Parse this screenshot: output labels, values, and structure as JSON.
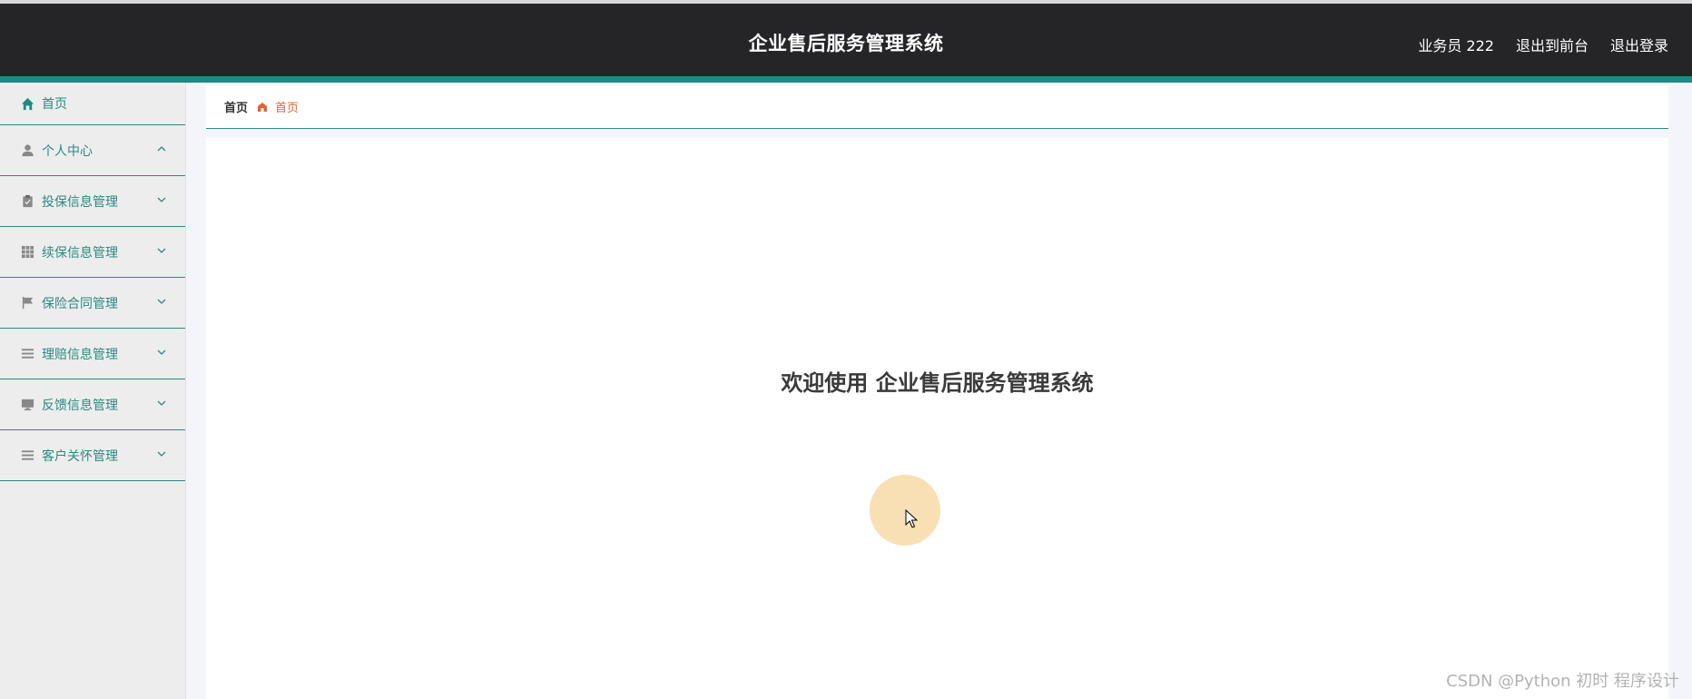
{
  "header": {
    "title": "企业售后服务管理系统",
    "user": "业务员 222",
    "back_to_front": "退出到前台",
    "logout": "退出登录"
  },
  "sidebar": {
    "items": [
      {
        "label": "首页",
        "icon": "home-icon"
      },
      {
        "label": "个人中心",
        "icon": "user-icon",
        "expanded": true
      },
      {
        "label": "投保信息管理",
        "icon": "clipboard-icon",
        "expanded": false
      },
      {
        "label": "续保信息管理",
        "icon": "grid-icon",
        "expanded": false
      },
      {
        "label": "保险合同管理",
        "icon": "flag-icon",
        "expanded": false
      },
      {
        "label": "理赔信息管理",
        "icon": "list-icon",
        "expanded": false
      },
      {
        "label": "反馈信息管理",
        "icon": "monitor-icon",
        "expanded": false
      },
      {
        "label": "客户关怀管理",
        "icon": "list-icon",
        "expanded": false
      }
    ]
  },
  "breadcrumb": {
    "root": "首页",
    "current": "首页"
  },
  "main": {
    "welcome": "欢迎使用 企业售后服务管理系统"
  },
  "watermark": "CSDN @Python 初时 程序设计",
  "colors": {
    "header_bg": "#252427",
    "accent": "#1a8c82",
    "sidebar_text": "#2a8a80",
    "breadcrumb_current": "#e5622f"
  }
}
